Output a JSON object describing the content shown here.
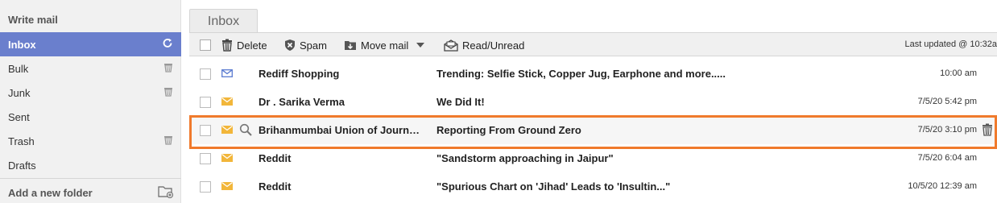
{
  "sidebar": {
    "compose": "Write mail",
    "items": [
      {
        "label": "Inbox",
        "icon": "refresh-icon"
      },
      {
        "label": "Bulk",
        "icon": "trash-icon"
      },
      {
        "label": "Junk",
        "icon": "trash-icon"
      },
      {
        "label": "Sent",
        "icon": ""
      },
      {
        "label": "Trash",
        "icon": "trash-icon"
      },
      {
        "label": "Drafts",
        "icon": ""
      }
    ],
    "add_folder": "Add a new folder"
  },
  "tab": {
    "label": "Inbox"
  },
  "toolbar": {
    "delete": "Delete",
    "spam": "Spam",
    "move": "Move mail",
    "read_unread": "Read/Unread",
    "last_updated": "Last updated  @ 10:32a"
  },
  "messages": [
    {
      "from": "Rediff Shopping",
      "subject": "Trending: Selfie Stick, Copper Jug, Earphone and more.....",
      "date": "10:00 am",
      "envelope": "blue"
    },
    {
      "from": "Dr . Sarika Verma",
      "subject": "We Did It!",
      "date": "7/5/20 5:42 pm",
      "envelope": "yellow"
    },
    {
      "from": "Brihanmumbai Union of Journ…",
      "subject": "Reporting From Ground Zero",
      "date": "7/5/20 3:10 pm",
      "envelope": "yellow"
    },
    {
      "from": "Reddit",
      "subject": "\"Sandstorm approaching in Jaipur\"",
      "date": "7/5/20 6:04 am",
      "envelope": "yellow"
    },
    {
      "from": "Reddit",
      "subject": "\"Spurious Chart on 'Jihad' Leads to 'Insultin...\"",
      "date": "10/5/20 12:39 am",
      "envelope": "yellow"
    }
  ],
  "colors": {
    "accent": "#6a7fcd",
    "highlight": "#f07a2c",
    "envelope_yellow": "#f2b63a",
    "envelope_blue": "#5a7bd1"
  }
}
